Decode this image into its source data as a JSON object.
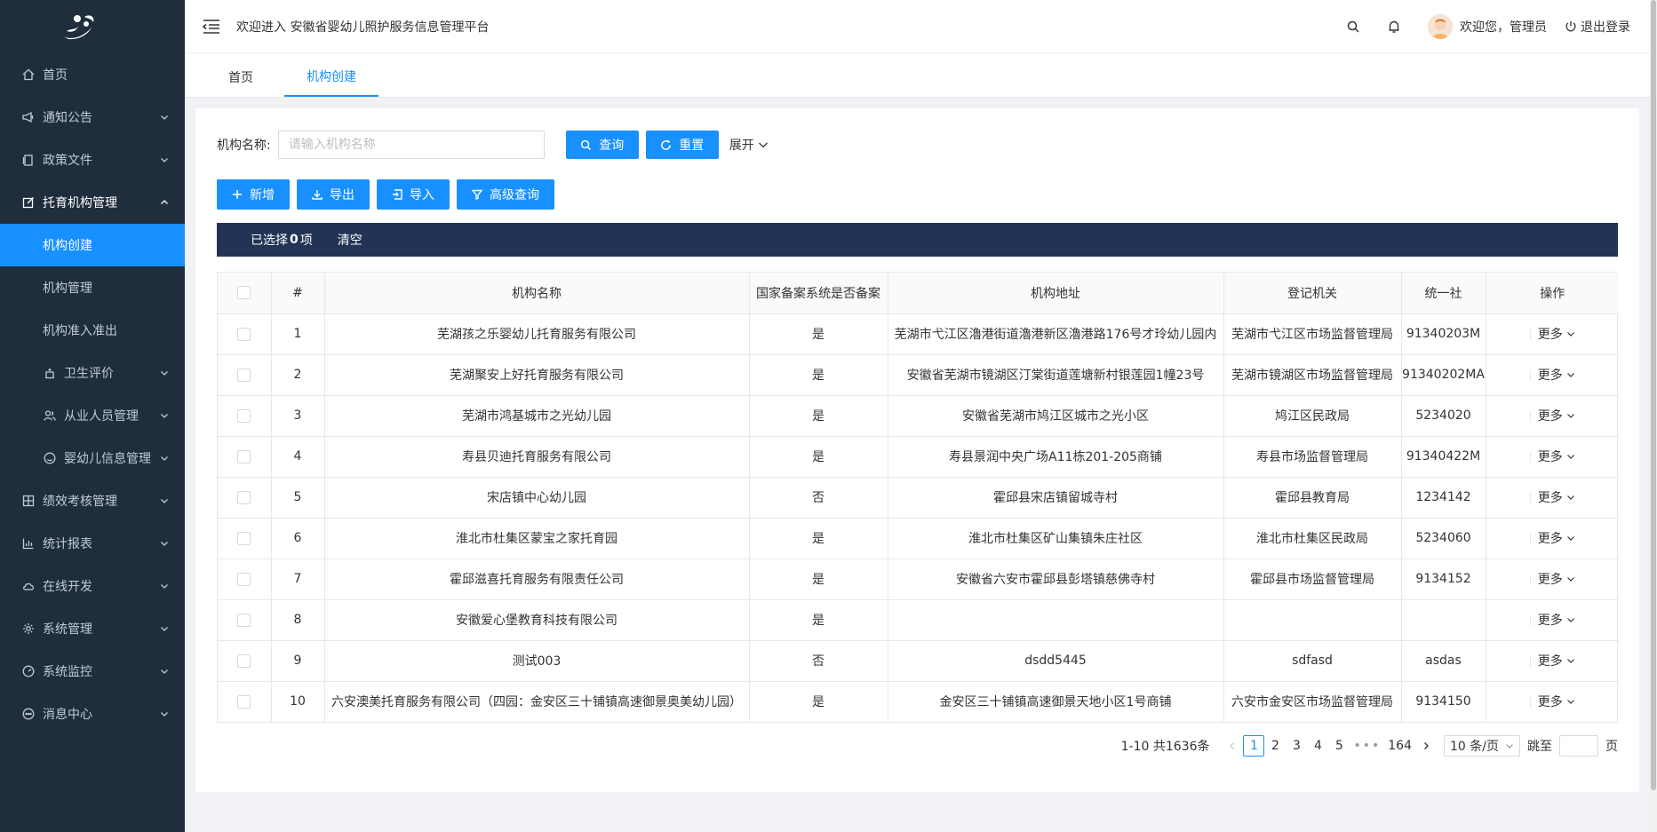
{
  "header": {
    "welcome": "欢迎进入 安徽省婴幼儿照护服务信息管理平台",
    "user_text": "欢迎您，管理员",
    "logout_label": "退出登录"
  },
  "sidebar": {
    "items": [
      {
        "label": "首页",
        "icon": "home-icon"
      },
      {
        "label": "通知公告",
        "icon": "megaphone-icon"
      },
      {
        "label": "政策文件",
        "icon": "document-icon"
      },
      {
        "label": "托育机构管理",
        "icon": "edit-icon"
      },
      {
        "label": "绩效考核管理",
        "icon": "grid-icon"
      },
      {
        "label": "统计报表",
        "icon": "bar-chart-icon"
      },
      {
        "label": "在线开发",
        "icon": "cloud-icon"
      },
      {
        "label": "系统管理",
        "icon": "gear-icon"
      },
      {
        "label": "系统监控",
        "icon": "dashboard-icon"
      },
      {
        "label": "消息中心",
        "icon": "chat-icon"
      }
    ],
    "submenu": [
      {
        "label": "机构创建"
      },
      {
        "label": "机构管理"
      },
      {
        "label": "机构准入准出"
      },
      {
        "label": "卫生评价",
        "icon": "health-icon"
      },
      {
        "label": "从业人员管理",
        "icon": "user-group-icon"
      },
      {
        "label": "婴幼儿信息管理",
        "icon": "smile-icon"
      }
    ]
  },
  "tabs": [
    {
      "label": "首页"
    },
    {
      "label": "机构创建"
    }
  ],
  "search": {
    "label": "机构名称:",
    "placeholder": "请输入机构名称",
    "query_label": "查询",
    "reset_label": "重置",
    "expand_label": "展开"
  },
  "toolbar": {
    "add_label": "新增",
    "export_label": "导出",
    "import_label": "导入",
    "advanced_label": "高级查询"
  },
  "selection": {
    "prefix": "已选择",
    "count": "0",
    "suffix": "项",
    "clear_label": "清空"
  },
  "table": {
    "headers": [
      "#",
      "机构名称",
      "国家备案系统是否备案",
      "机构地址",
      "登记机关",
      "统一社",
      "操作"
    ],
    "more_label": "更多",
    "rows": [
      {
        "num": "1",
        "name": "芜湖孩之乐婴幼儿托育服务有限公司",
        "filed": "是",
        "address": "芜湖市弋江区瀂港街道瀂港新区瀂港路176号才玲幼儿园内",
        "authority": "芜湖市弋江区市场监督管理局",
        "code": "91340203M"
      },
      {
        "num": "2",
        "name": "芜湖聚安上好托育服务有限公司",
        "filed": "是",
        "address": "安徽省芜湖市镜湖区汀棠街道莲塘新村银莲园1幢23号",
        "authority": "芜湖市镜湖区市场监督管理局",
        "code": "91340202MA"
      },
      {
        "num": "3",
        "name": "芜湖市鸿基城市之光幼儿园",
        "filed": "是",
        "address": "安徽省芜湖市鸠江区城市之光小区",
        "authority": "鸠江区民政局",
        "code": "5234020"
      },
      {
        "num": "4",
        "name": "寿县贝迪托育服务有限公司",
        "filed": "是",
        "address": "寿县景润中央广场A11栋201-205商铺",
        "authority": "寿县市场监督管理局",
        "code": "91340422M"
      },
      {
        "num": "5",
        "name": "宋店镇中心幼儿园",
        "filed": "否",
        "address": "霍邱县宋店镇留城寺村",
        "authority": "霍邱县教育局",
        "code": "1234142"
      },
      {
        "num": "6",
        "name": "淮北市杜集区蒙宝之家托育园",
        "filed": "是",
        "address": "淮北市杜集区矿山集镇朱庄社区",
        "authority": "淮北市杜集区民政局",
        "code": "5234060"
      },
      {
        "num": "7",
        "name": "霍邱滋喜托育服务有限责任公司",
        "filed": "是",
        "address": "安徽省六安市霍邱县彭塔镇慈佛寺村",
        "authority": "霍邱县市场监督管理局",
        "code": "9134152"
      },
      {
        "num": "8",
        "name": "安徽爱心堡教育科技有限公司",
        "filed": "是",
        "address": "",
        "authority": "",
        "code": ""
      },
      {
        "num": "9",
        "name": "测试003",
        "filed": "否",
        "address": "dsdd5445",
        "authority": "sdfasd",
        "code": "asdas"
      },
      {
        "num": "10",
        "name": "六安澳美托育服务有限公司（四园：金安区三十铺镇高速御景奥美幼儿园）",
        "filed": "是",
        "address": "金安区三十铺镇高速御景天地小区1号商铺",
        "authority": "六安市金安区市场监督管理局",
        "code": "9134150"
      }
    ]
  },
  "pagination": {
    "total_text": "1-10 共1636条",
    "pages": [
      "1",
      "2",
      "3",
      "4",
      "5"
    ],
    "dots": "•••",
    "last_page": "164",
    "page_size": "10 条/页",
    "jump_label": "跳至",
    "page_suffix": "页"
  },
  "colors": {
    "sidebar_bg": "#1f2d3d",
    "primary": "#1890ff",
    "selection_bar": "#223355"
  }
}
